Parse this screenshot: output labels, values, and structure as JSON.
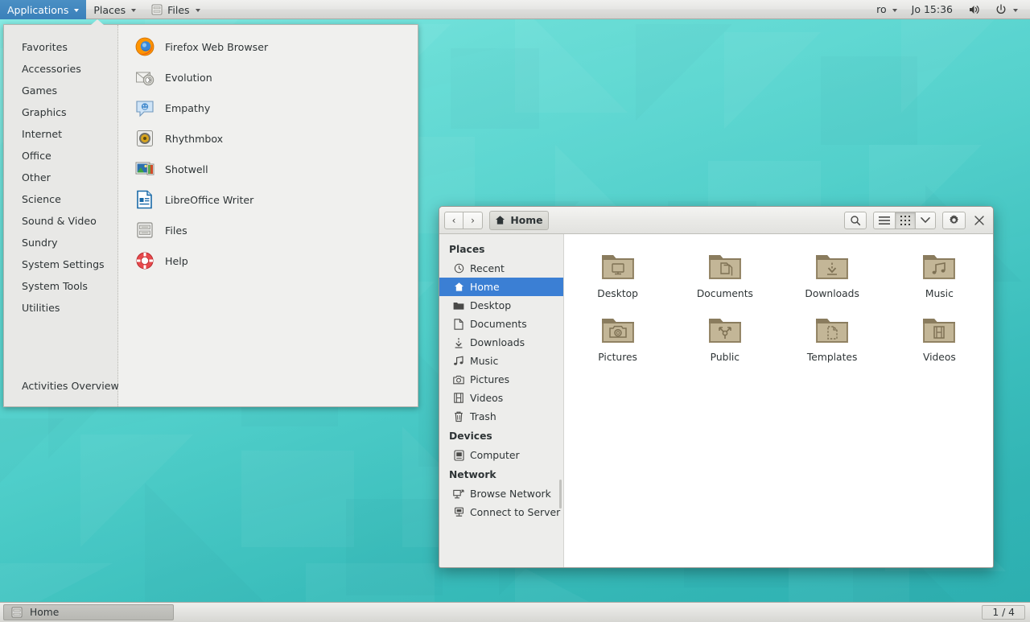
{
  "top_panel": {
    "applications_label": "Applications",
    "places_label": "Places",
    "window_menu_label": "Files",
    "keyboard_layout": "ro",
    "clock": "Jo 15:36",
    "volume_icon": "volume-icon",
    "power_icon": "power-icon"
  },
  "applications_menu": {
    "categories": [
      {
        "label": "Favorites"
      },
      {
        "label": "Accessories"
      },
      {
        "label": "Games"
      },
      {
        "label": "Graphics"
      },
      {
        "label": "Internet"
      },
      {
        "label": "Office"
      },
      {
        "label": "Other"
      },
      {
        "label": "Science"
      },
      {
        "label": "Sound & Video"
      },
      {
        "label": "Sundry"
      },
      {
        "label": "System Settings"
      },
      {
        "label": "System Tools"
      },
      {
        "label": "Utilities"
      }
    ],
    "activities_overview_label": "Activities Overview",
    "apps": [
      {
        "label": "Firefox Web Browser",
        "icon": "firefox-icon"
      },
      {
        "label": "Evolution",
        "icon": "evolution-icon"
      },
      {
        "label": "Empathy",
        "icon": "empathy-icon"
      },
      {
        "label": "Rhythmbox",
        "icon": "rhythmbox-icon"
      },
      {
        "label": "Shotwell",
        "icon": "shotwell-icon"
      },
      {
        "label": "LibreOffice Writer",
        "icon": "libreoffice-writer-icon"
      },
      {
        "label": "Files",
        "icon": "files-icon"
      },
      {
        "label": "Help",
        "icon": "help-icon"
      }
    ]
  },
  "files_window": {
    "title": "Home",
    "back_label": "‹",
    "forward_label": "›",
    "pathbar_label": "Home",
    "toolbar": {
      "search_icon": "search-icon",
      "list_view_icon": "list-view-icon",
      "grid_view_icon": "grid-view-icon",
      "view_options_icon": "chevron-down-icon",
      "settings_icon": "gear-icon",
      "close_icon": "close-icon"
    },
    "sidebar": {
      "sections": [
        {
          "heading": "Places",
          "items": [
            {
              "label": "Recent",
              "icon": "clock-icon",
              "selected": false
            },
            {
              "label": "Home",
              "icon": "home-icon",
              "selected": true
            },
            {
              "label": "Desktop",
              "icon": "folder-icon",
              "selected": false
            },
            {
              "label": "Documents",
              "icon": "document-icon",
              "selected": false
            },
            {
              "label": "Downloads",
              "icon": "download-icon",
              "selected": false
            },
            {
              "label": "Music",
              "icon": "music-note-icon",
              "selected": false
            },
            {
              "label": "Pictures",
              "icon": "camera-icon",
              "selected": false
            },
            {
              "label": "Videos",
              "icon": "film-icon",
              "selected": false
            },
            {
              "label": "Trash",
              "icon": "trash-icon",
              "selected": false
            }
          ]
        },
        {
          "heading": "Devices",
          "items": [
            {
              "label": "Computer",
              "icon": "computer-icon",
              "selected": false
            }
          ]
        },
        {
          "heading": "Network",
          "items": [
            {
              "label": "Browse Network",
              "icon": "network-icon",
              "selected": false
            },
            {
              "label": "Connect to Server",
              "icon": "server-icon",
              "selected": false
            }
          ]
        }
      ]
    },
    "files": [
      {
        "label": "Desktop",
        "emblem": "desktop-emblem"
      },
      {
        "label": "Documents",
        "emblem": "documents-emblem"
      },
      {
        "label": "Downloads",
        "emblem": "downloads-emblem"
      },
      {
        "label": "Music",
        "emblem": "music-emblem"
      },
      {
        "label": "Pictures",
        "emblem": "pictures-emblem"
      },
      {
        "label": "Public",
        "emblem": "public-emblem"
      },
      {
        "label": "Templates",
        "emblem": "templates-emblem"
      },
      {
        "label": "Videos",
        "emblem": "videos-emblem"
      }
    ]
  },
  "bottom_panel": {
    "task_label": "Home",
    "task_icon": "files-icon",
    "workspace_indicator": "1 / 4"
  },
  "colors": {
    "desktop_top": "#7eeae2",
    "desktop_bottom": "#2fb3b4",
    "panel_bg": "#e3e3e0",
    "menu_active": "#3a80ba",
    "sidebar_selected": "#3b7fd4",
    "folder": "#b5a789"
  }
}
